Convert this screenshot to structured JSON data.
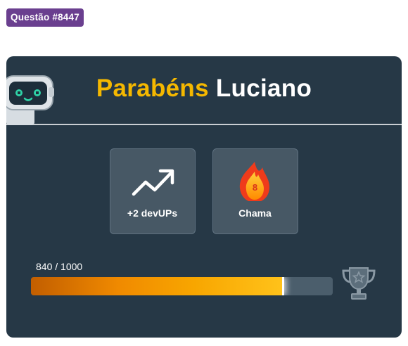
{
  "question_badge": "Questão #8447",
  "card": {
    "title_prefix": "Parabéns",
    "title_name": "Luciano",
    "stats": [
      {
        "icon": "trending-up-icon",
        "label": "+2 devUPs"
      },
      {
        "icon": "flame-icon",
        "value": "8",
        "label": "Chama"
      }
    ],
    "progress": {
      "label": "840 / 1000",
      "current": 840,
      "max": 1000
    },
    "reward_icon": "trophy-icon"
  },
  "colors": {
    "badge": "#6a3f8f",
    "card_bg": "#263846",
    "title_accent": "#f5b800",
    "progress_fill": "#f8a600"
  }
}
